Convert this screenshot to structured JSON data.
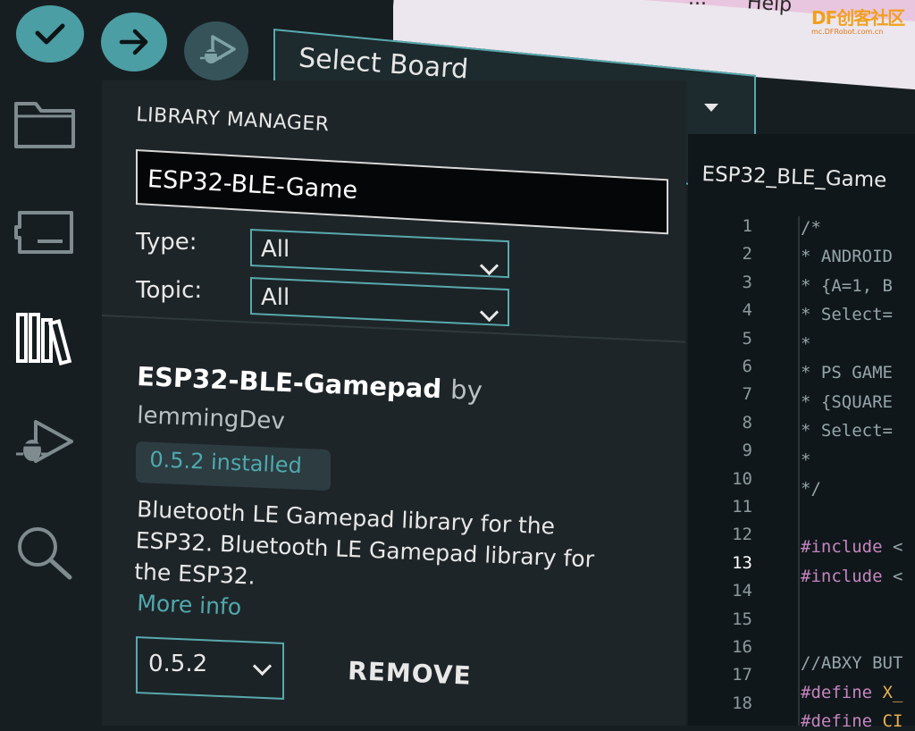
{
  "menubar": {
    "cut_label": "...",
    "help_label": "Help"
  },
  "watermark": {
    "main": "DF创客社区",
    "sub": "mc.DFRobot.com.cn"
  },
  "toolbar": {
    "verify_icon": "checkmark-icon",
    "upload_icon": "arrow-right-icon",
    "debug_icon": "debug-icon",
    "board_label": "Select Board"
  },
  "sidebar": {
    "items": [
      "folder-icon",
      "boards-manager-icon",
      "library-icon",
      "debug-icon",
      "search-icon"
    ],
    "active": "library-icon"
  },
  "library_manager": {
    "title": "LIBRARY MANAGER",
    "search_value": "ESP32-BLE-Game",
    "type_label": "Type:",
    "type_value": "All",
    "topic_label": "Topic:",
    "topic_value": "All"
  },
  "library": {
    "name": "ESP32-BLE-Gamepad",
    "by": "by",
    "author": "lemmingDev",
    "installed_badge": "0.5.2 installed",
    "description": "Bluetooth LE Gamepad library for the ESP32. Bluetooth LE Gamepad library for the ESP32.",
    "more_info": "More info",
    "version_value": "0.5.2",
    "remove_label": "REMOVE"
  },
  "editor": {
    "tab_label": "ESP32_BLE_Game",
    "active_line": 13,
    "line_numbers": [
      "1",
      "2",
      "3",
      "4",
      "5",
      "6",
      "7",
      "8",
      "9",
      "10",
      "11",
      "12",
      "13",
      "14",
      "15",
      "16",
      "17",
      "18"
    ],
    "lines": [
      "/*",
      " * ANDROID",
      " * {A=1, B",
      " * Select=",
      " *",
      " * PS GAME",
      " * {SQUARE",
      " * Select=",
      " *",
      " */",
      "",
      "#include <",
      "#include <",
      "",
      "",
      "//ABXY BUT",
      "#define X_",
      "#define CI"
    ]
  },
  "colors": {
    "accent": "#4b9ea3",
    "keyword": "#c586c0",
    "define_value": "#e8b04f",
    "background": "#171e21"
  }
}
